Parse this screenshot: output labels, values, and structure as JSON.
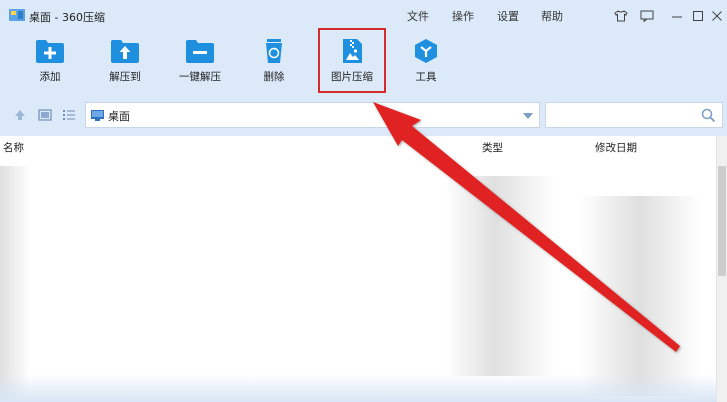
{
  "window": {
    "title": "桌面 - 360压缩",
    "menu": [
      "文件",
      "操作",
      "设置",
      "帮助"
    ]
  },
  "toolbar": {
    "items": [
      {
        "label": "添加",
        "icon": "add-file-icon"
      },
      {
        "label": "解压到",
        "icon": "extract-to-icon"
      },
      {
        "label": "一键解压",
        "icon": "one-click-extract-icon"
      },
      {
        "label": "删除",
        "icon": "recycle-bin-icon"
      },
      {
        "label": "图片压缩",
        "icon": "image-compress-icon"
      },
      {
        "label": "工具",
        "icon": "tools-icon"
      }
    ],
    "highlighted": "图片压缩"
  },
  "address": {
    "path": "桌面",
    "search_placeholder": ""
  },
  "columns": [
    "名称",
    "类型",
    "修改日期"
  ],
  "colors": {
    "accent": "#1f8fe0",
    "highlight_box": "#d32a2a",
    "arrow": "#e02020",
    "chrome_bg": "#dbe9f8"
  }
}
